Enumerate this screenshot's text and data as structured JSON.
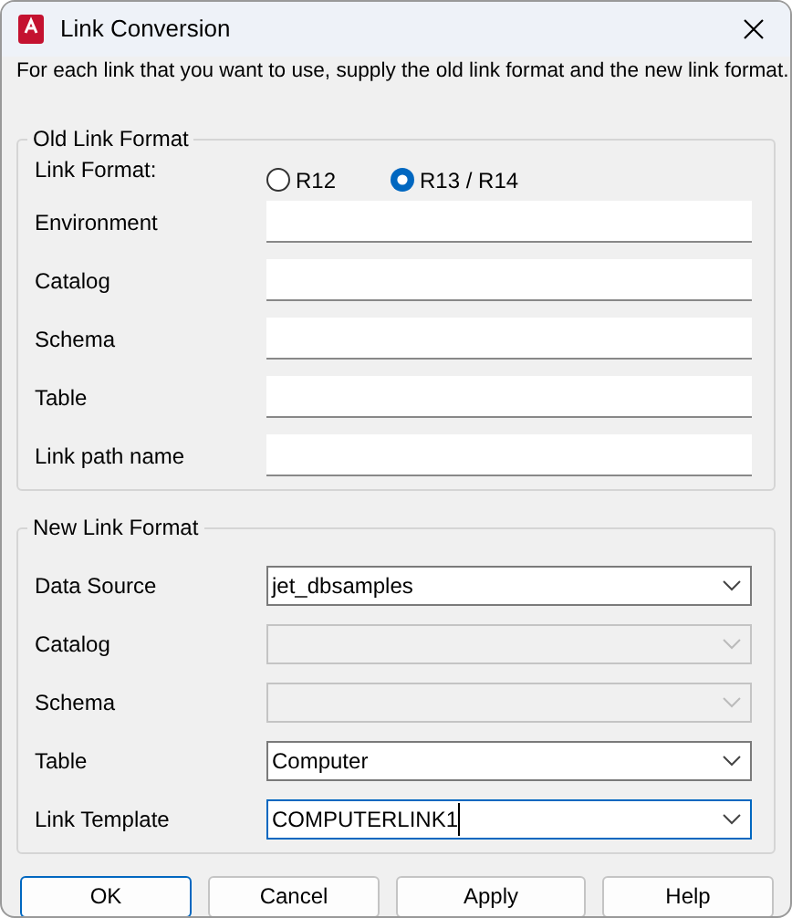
{
  "window": {
    "title": "Link Conversion"
  },
  "intro": "For each link that you want to use, supply the old link format and the new link format.",
  "old_link_format": {
    "title": "Old Link Format",
    "link_format_label": "Link Format:",
    "options": [
      {
        "label": "R12",
        "selected": false
      },
      {
        "label": "R13 / R14",
        "selected": true
      }
    ],
    "fields": [
      {
        "label": "Environment"
      },
      {
        "label": "Catalog"
      },
      {
        "label": "Schema"
      },
      {
        "label": "Table"
      },
      {
        "label": "Link path name"
      }
    ]
  },
  "new_link_format": {
    "title": "New Link Format",
    "fields": [
      {
        "label": "Data Source",
        "value": "jet_dbsamples",
        "disabled": false,
        "focused": false
      },
      {
        "label": "Catalog",
        "disabled": true,
        "focused": false
      },
      {
        "label": "Schema",
        "disabled": true,
        "focused": false
      },
      {
        "label": "Table",
        "value": "Computer",
        "disabled": false,
        "focused": false
      },
      {
        "label": "Link Template",
        "value": "COMPUTERLINK1",
        "disabled": false,
        "focused": true
      }
    ]
  },
  "buttons": [
    {
      "label": "OK",
      "default": true
    },
    {
      "label": "Cancel",
      "default": false
    },
    {
      "label": "Apply",
      "default": false
    },
    {
      "label": "Help",
      "default": false
    }
  ]
}
